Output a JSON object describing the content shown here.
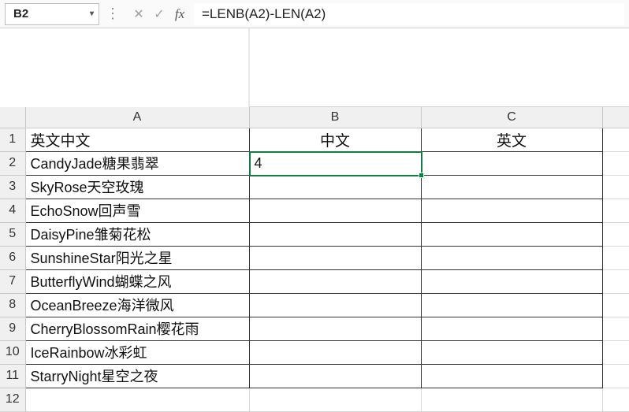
{
  "name_box": "B2",
  "formula": "=LENB(A2)-LEN(A2)",
  "columns": [
    "A",
    "B",
    "C"
  ],
  "row_headers": [
    "1",
    "2",
    "3",
    "4",
    "5",
    "6",
    "7",
    "8",
    "9",
    "10",
    "11",
    "12"
  ],
  "header_row": {
    "A": "英文中文",
    "B": "中文",
    "C": "英文"
  },
  "rows": [
    {
      "A": "CandyJade糖果翡翠",
      "B": "4",
      "C": ""
    },
    {
      "A": "SkyRose天空玫瑰",
      "B": "",
      "C": ""
    },
    {
      "A": "EchoSnow回声雪",
      "B": "",
      "C": ""
    },
    {
      "A": "DaisyPine雏菊花松",
      "B": "",
      "C": ""
    },
    {
      "A": "SunshineStar阳光之星",
      "B": "",
      "C": ""
    },
    {
      "A": "ButterflyWind蝴蝶之风",
      "B": "",
      "C": ""
    },
    {
      "A": "OceanBreeze海洋微风",
      "B": "",
      "C": ""
    },
    {
      "A": "CherryBlossomRain樱花雨",
      "B": "",
      "C": ""
    },
    {
      "A": "IceRainbow冰彩虹",
      "B": "",
      "C": ""
    },
    {
      "A": "StarryNight星空之夜",
      "B": "",
      "C": ""
    }
  ],
  "active_cell": "B2",
  "colors": {
    "selection": "#107c41",
    "grid": "#d8d8d8",
    "border_strong": "#333333"
  }
}
